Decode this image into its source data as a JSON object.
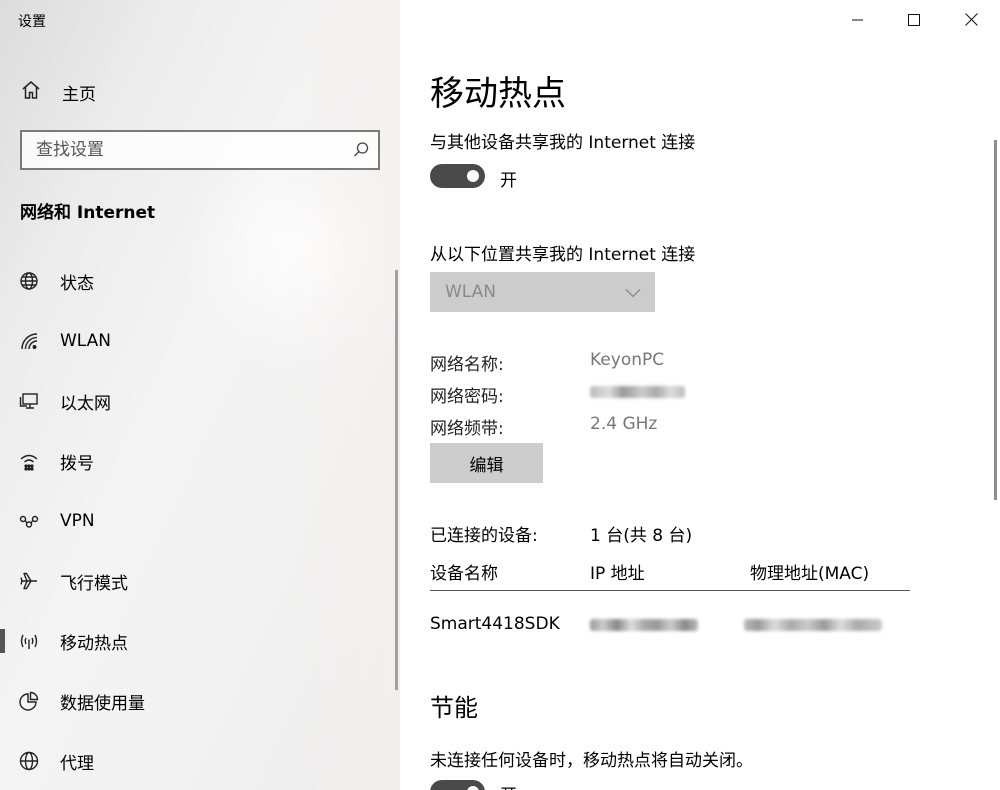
{
  "window": {
    "title": "设置"
  },
  "sidebar": {
    "home_label": "主页",
    "search_placeholder": "查找设置",
    "section_title": "网络和 Internet",
    "items": [
      {
        "label": "状态",
        "icon": "globe-status-icon"
      },
      {
        "label": "WLAN",
        "icon": "wifi-icon"
      },
      {
        "label": "以太网",
        "icon": "ethernet-icon"
      },
      {
        "label": "拨号",
        "icon": "dialup-icon"
      },
      {
        "label": "VPN",
        "icon": "vpn-icon"
      },
      {
        "label": "飞行模式",
        "icon": "airplane-icon"
      },
      {
        "label": "移动热点",
        "icon": "hotspot-icon",
        "active": true
      },
      {
        "label": "数据使用量",
        "icon": "pie-chart-icon"
      },
      {
        "label": "代理",
        "icon": "globe-icon"
      }
    ]
  },
  "main": {
    "title": "移动热点",
    "share_label": "与其他设备共享我的 Internet 连接",
    "share_toggle_label": "开",
    "share_from_label": "从以下位置共享我的 Internet 连接",
    "share_from_value": "WLAN",
    "network_name_key": "网络名称:",
    "network_name_value": "KeyonPC",
    "network_password_key": "网络密码:",
    "network_band_key": "网络频带:",
    "network_band_value": "2.4 GHz",
    "edit_button": "编辑",
    "connected_key": "已连接的设备:",
    "connected_value": "1 台(共 8 台)",
    "table": {
      "headers": [
        "设备名称",
        "IP 地址",
        "物理地址(MAC)"
      ],
      "rows": [
        {
          "name": "Smart4418SDK"
        }
      ]
    },
    "power_section_title": "节能",
    "power_description": "未连接任何设备时，移动热点将自动关闭。",
    "power_toggle_label": "开"
  },
  "colors": {
    "toggle_on": "#4a4a4a",
    "button_bg": "#cccccc",
    "active_indicator": "#555555"
  }
}
